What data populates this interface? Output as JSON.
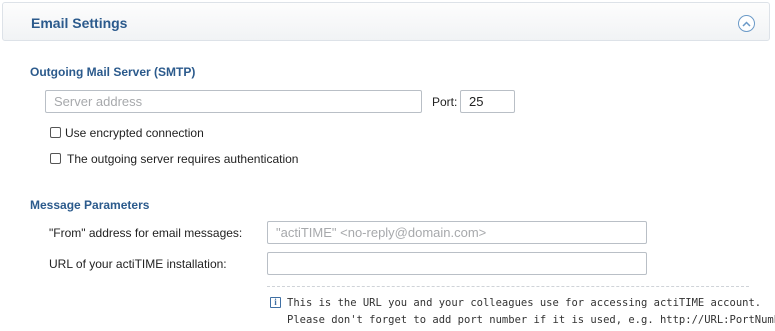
{
  "header": {
    "title": "Email Settings"
  },
  "smtp": {
    "section_title": "Outgoing Mail Server (SMTP)",
    "server_placeholder": "Server address",
    "server_value": "",
    "port_label": "Port:",
    "port_value": "25",
    "encrypted_label": "Use encrypted connection",
    "encrypted_checked": false,
    "auth_label": "The outgoing server requires authentication",
    "auth_checked": false
  },
  "message": {
    "section_title": "Message Parameters",
    "from_label": "\"From\" address for email messages:",
    "from_placeholder": "\"actiTIME\" <no-reply@domain.com>",
    "from_value": "",
    "url_label": "URL of your actiTIME installation:",
    "url_value": "",
    "hint_line1": "This is the URL you and your colleagues use for accessing actiTIME account.",
    "hint_line2": "Please don't forget to add port number if it is used, e.g. http://URL:PortNumber"
  },
  "colors": {
    "accent": "#2b5a8c",
    "collapse_icon": "#6b9ac8",
    "placeholder": "#a7a9ac",
    "input_border": "#b9bfc6"
  },
  "icons": {
    "collapse": "chevron-up-icon",
    "info": "info-icon"
  }
}
